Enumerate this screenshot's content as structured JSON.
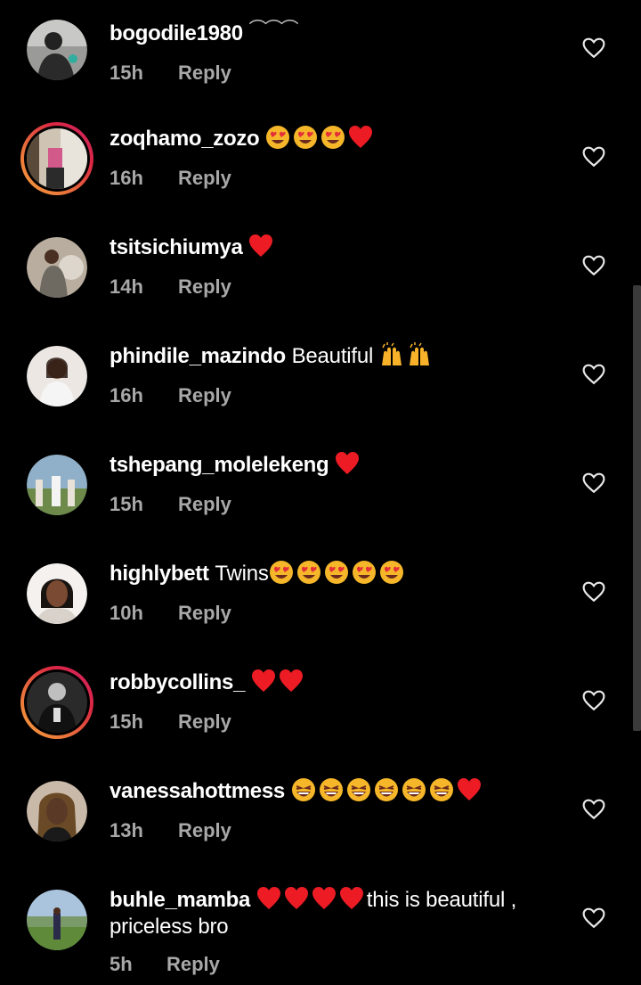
{
  "colors": {
    "background": "#000000",
    "text": "#ffffff",
    "secondary": "#a8a8a8",
    "heart_emoji": "#ed1c24",
    "story_ring": "#e6683c"
  },
  "comments": [
    {
      "username": "bogodile1980",
      "text": "",
      "emojis": [
        "tilde",
        "tilde",
        "tilde"
      ],
      "time": "15h",
      "reply": "Reply",
      "story": false
    },
    {
      "username": "zoqhamo_zozo",
      "text": "",
      "emojis": [
        "heart-eyes",
        "heart-eyes",
        "heart-eyes",
        "red-heart"
      ],
      "time": "16h",
      "reply": "Reply",
      "story": true
    },
    {
      "username": "tsitsichiumya",
      "text": "",
      "emojis": [
        "red-heart"
      ],
      "time": "14h",
      "reply": "Reply",
      "story": false
    },
    {
      "username": "phindile_mazindo",
      "text": "Beautiful",
      "emojis": [
        "raising-hands",
        "raising-hands"
      ],
      "time": "16h",
      "reply": "Reply",
      "story": false
    },
    {
      "username": "tshepang_molelekeng",
      "text": "",
      "emojis": [
        "red-heart"
      ],
      "time": "15h",
      "reply": "Reply",
      "story": false
    },
    {
      "username": "highlybett",
      "text": "Twins",
      "emojis": [
        "heart-eyes",
        "heart-eyes",
        "heart-eyes",
        "heart-eyes",
        "heart-eyes"
      ],
      "time": "10h",
      "reply": "Reply",
      "story": false
    },
    {
      "username": "robbycollins_",
      "text": "",
      "emojis": [
        "red-heart",
        "red-heart"
      ],
      "time": "15h",
      "reply": "Reply",
      "story": true
    },
    {
      "username": "vanessahottmess",
      "text": "",
      "emojis": [
        "laughing",
        "laughing",
        "laughing",
        "laughing",
        "laughing",
        "laughing",
        "red-heart"
      ],
      "time": "13h",
      "reply": "Reply",
      "story": false
    },
    {
      "username": "buhle_mamba",
      "text": "this is beautiful ,",
      "text2": "priceless bro",
      "emojis": [
        "red-heart",
        "red-heart",
        "red-heart",
        "red-heart"
      ],
      "time": "5h",
      "reply": "Reply",
      "story": false
    }
  ]
}
